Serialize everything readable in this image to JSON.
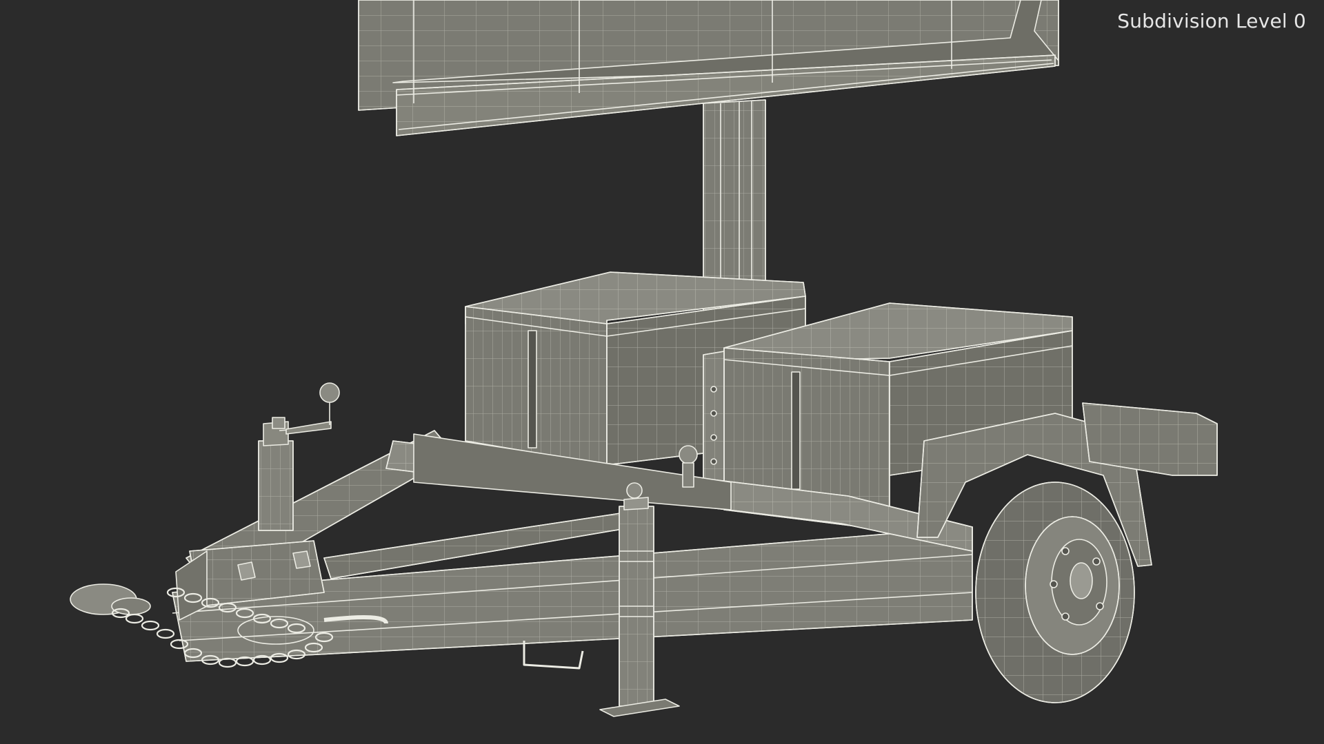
{
  "overlay": {
    "subdivision_label": "Subdivision Level 0"
  },
  "scene": {
    "subject": "message-sign-trailer-wireframe",
    "background_color": "#2b2b2b",
    "surface_color": "#7a7a72",
    "wire_color": "#e8e8e0"
  }
}
